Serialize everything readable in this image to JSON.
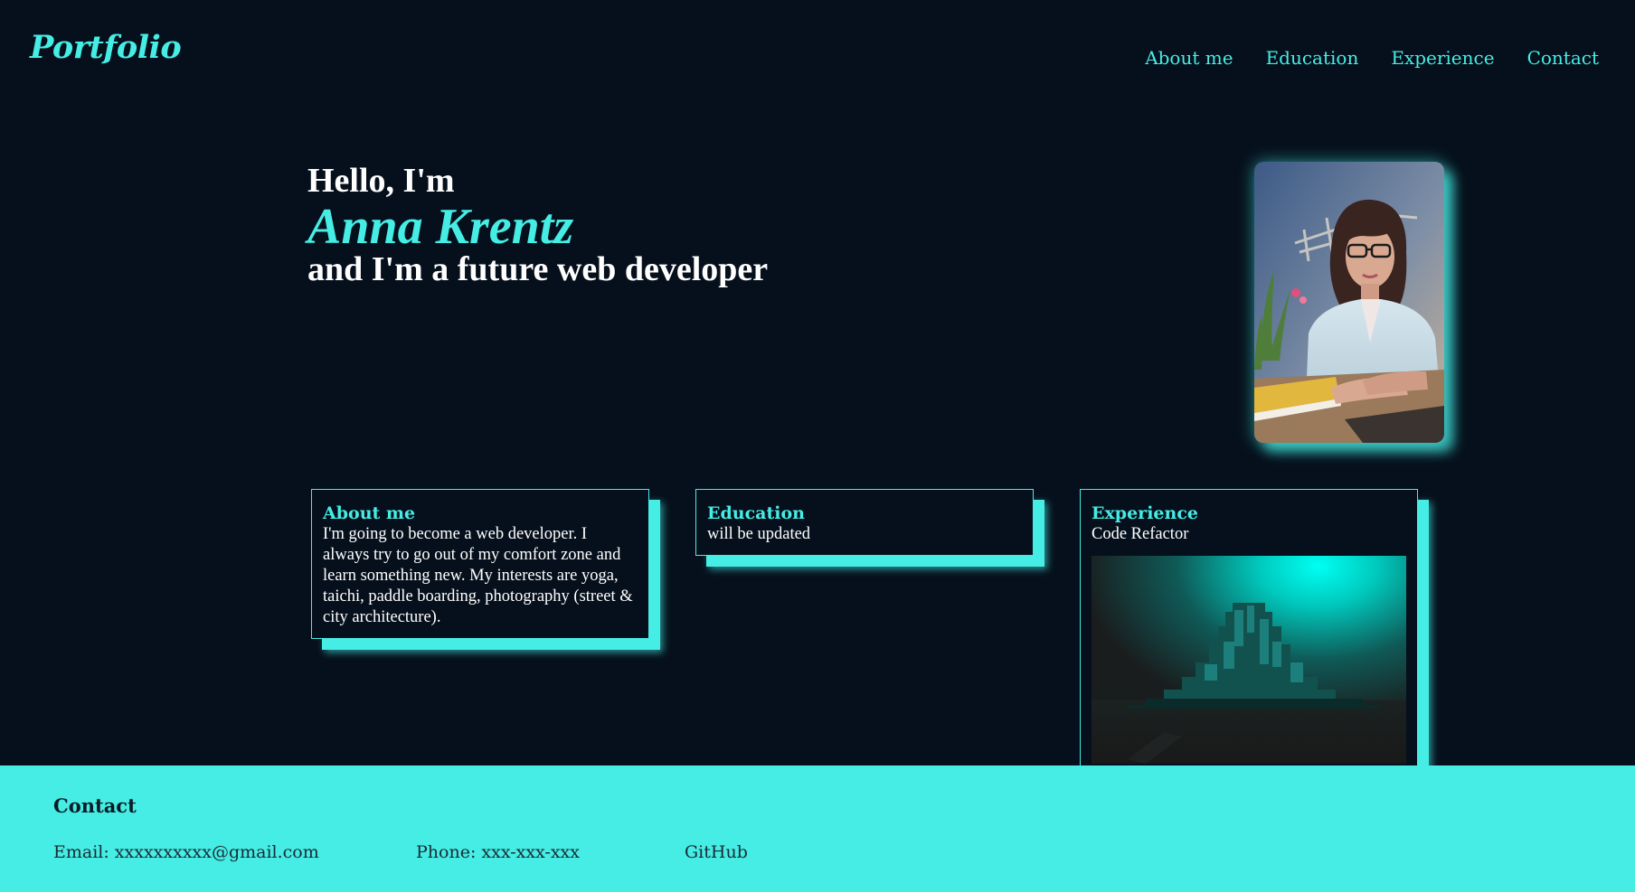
{
  "header": {
    "logo": "Portfolio",
    "nav": [
      "About me",
      "Education",
      "Experience",
      "Contact"
    ]
  },
  "hero": {
    "greeting": "Hello, I'm",
    "name": "Anna Krentz",
    "tagline": "and I'm a future web developer"
  },
  "cards": {
    "about": {
      "title": "About me",
      "text": "I'm going to become a web developer. I always try to go out of my comfort zone and learn something new. My interests are yoga, taichi, paddle boarding, photography (street & city architecture)."
    },
    "education": {
      "title": "Education",
      "text": "will be updated"
    },
    "experience": {
      "title": "Experience",
      "text": "Code Refactor"
    }
  },
  "footer": {
    "title": "Contact",
    "email": "Email: xxxxxxxxxx@gmail.com",
    "phone": "Phone: xxx-xxx-xxx",
    "github": "GitHub"
  },
  "colors": {
    "background": "#06101c",
    "accent": "#45ede5",
    "text": "#ffffff"
  }
}
